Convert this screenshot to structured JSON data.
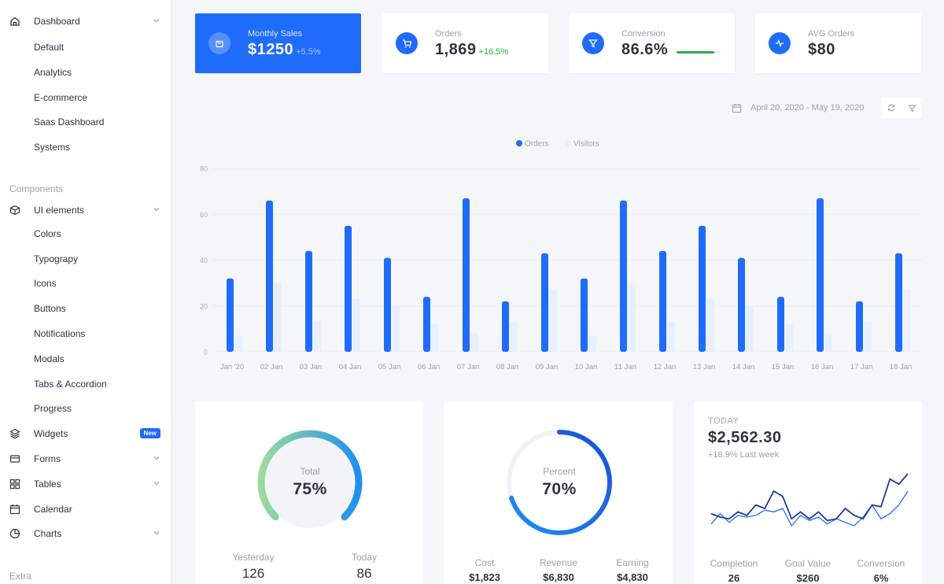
{
  "sidebar": {
    "dashboard": {
      "label": "Dashboard",
      "icon": "home-icon"
    },
    "dashboard_items": [
      "Default",
      "Analytics",
      "E-commerce",
      "Saas Dashboard",
      "Systems"
    ],
    "components_heading": "Components",
    "ui_elements": {
      "label": "UI elements",
      "icon": "cube-icon"
    },
    "ui_items": [
      "Colors",
      "Typograpy",
      "Icons",
      "Buttons",
      "Notifications",
      "Modals",
      "Tabs & Accordion",
      "Progress"
    ],
    "widgets": {
      "label": "Widgets",
      "icon": "layers-icon",
      "badge": "New"
    },
    "forms": {
      "label": "Forms",
      "icon": "card-icon"
    },
    "tables": {
      "label": "Tables",
      "icon": "grid-icon"
    },
    "calendar": {
      "label": "Calendar",
      "icon": "calendar-icon"
    },
    "charts": {
      "label": "Charts",
      "icon": "pie-icon"
    },
    "extra_heading": "Extra"
  },
  "stats": {
    "sales": {
      "label": "Monthly Sales",
      "value": "$1250",
      "change": "+5.5%",
      "icon": "bag-icon"
    },
    "orders": {
      "label": "Orders",
      "value": "1,869",
      "change": "+16.5%",
      "icon": "cart-icon"
    },
    "conversion": {
      "label": "Conversion",
      "value": "86.6%",
      "progress": 0.86,
      "icon": "filter-icon"
    },
    "avg": {
      "label": "AVG Orders",
      "value": "$80",
      "icon": "activity-icon"
    }
  },
  "date_range": "April 20, 2020 - May 19, 2020",
  "colors": {
    "primary": "#1e6cf9",
    "secondary": "#e8efff",
    "green": "#2fa84f"
  },
  "chart_data": {
    "type": "bar",
    "legend": [
      "Orders",
      "Visitors"
    ],
    "categories": [
      "Jan '20",
      "02 Jan",
      "03 Jan",
      "04 Jan",
      "05 Jan",
      "06 Jan",
      "07 Jan",
      "08 Jan",
      "09 Jan",
      "10 Jan",
      "11 Jan",
      "12 Jan",
      "13 Jan",
      "14 Jan",
      "15 Jan",
      "16 Jan",
      "17 Jan",
      "18 Jan"
    ],
    "series": [
      {
        "name": "Orders",
        "color": "#1e6cf9",
        "values": [
          32,
          66,
          44,
          55,
          41,
          24,
          67,
          22,
          43,
          32,
          66,
          44,
          55,
          41,
          24,
          67,
          22,
          43
        ]
      },
      {
        "name": "Visitors",
        "color": "#e8efff",
        "values": [
          7,
          30,
          13,
          23,
          20,
          12,
          8,
          13,
          27,
          7,
          30,
          13,
          23,
          20,
          12,
          8,
          13,
          27
        ]
      }
    ],
    "yticks": [
      0,
      20,
      40,
      60,
      80
    ],
    "ylim": [
      0,
      80
    ],
    "legend_position": "top-center",
    "grid": true
  },
  "total_card": {
    "label": "Total",
    "value": "75%",
    "fraction": 0.75,
    "yesterday_label": "Yesterday",
    "yesterday_value": "126",
    "today_label": "Today",
    "today_value": "86"
  },
  "percent_card": {
    "label": "Percent",
    "value": "70%",
    "fraction": 0.7,
    "cost_label": "Cost",
    "cost_value": "$1,823",
    "revenue_label": "Revenue",
    "revenue_value": "$6,830",
    "earning_label": "Earning",
    "earning_value": "$4,830"
  },
  "today_card": {
    "label": "TODAY",
    "value": "$2,562.30",
    "change": "+18.9% Last week",
    "completion_label": "Completion",
    "completion_value": "26",
    "goal_label": "Goal Value",
    "goal_value": "$260",
    "conversion_label": "Conversion",
    "conversion_value": "6%",
    "series_a": [
      33,
      31,
      30,
      34,
      32,
      38,
      36,
      46,
      43,
      30,
      34,
      30,
      34,
      29,
      30,
      36,
      32,
      30,
      38,
      37,
      53,
      50,
      56
    ],
    "series_b": [
      27,
      33,
      28,
      32,
      31,
      32,
      35,
      34,
      36,
      26,
      32,
      29,
      31,
      27,
      30,
      28,
      26,
      31,
      38,
      30,
      33,
      38,
      46
    ]
  }
}
